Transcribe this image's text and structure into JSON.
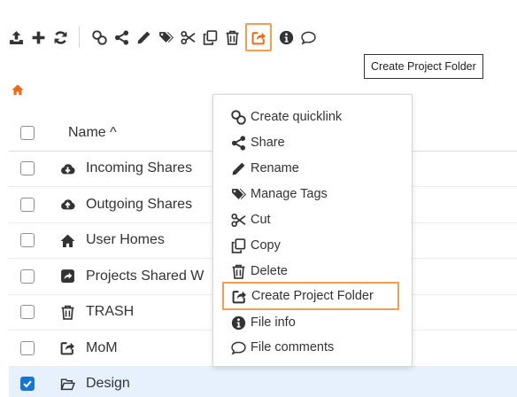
{
  "toolbar": {
    "buttons": [
      {
        "icon": "upload-icon"
      },
      {
        "icon": "plus-icon"
      },
      {
        "icon": "refresh-icon"
      },
      {
        "icon": "link-icon"
      },
      {
        "icon": "share-icon"
      },
      {
        "icon": "pencil-icon"
      },
      {
        "icon": "tags-icon"
      },
      {
        "icon": "scissors-icon"
      },
      {
        "icon": "copy-icon"
      },
      {
        "icon": "trash-icon"
      },
      {
        "icon": "project-folder-icon"
      },
      {
        "icon": "info-icon"
      },
      {
        "icon": "comment-icon"
      }
    ],
    "tooltip": "Create Project Folder"
  },
  "breadcrumb": {
    "icon": "home-icon"
  },
  "list": {
    "header": {
      "name_label": "Name ^"
    },
    "rows": [
      {
        "label": "Incoming Shares",
        "icon": "cloud-download-icon",
        "checked": false
      },
      {
        "label": "Outgoing Shares",
        "icon": "cloud-upload-icon",
        "checked": false
      },
      {
        "label": "User Homes",
        "icon": "home-icon",
        "checked": false
      },
      {
        "label": "Projects Shared W",
        "icon": "share-square-icon",
        "checked": false
      },
      {
        "label": "TRASH",
        "icon": "trash-icon",
        "checked": false
      },
      {
        "label": "MoM",
        "icon": "project-folder-icon",
        "checked": false
      },
      {
        "label": "Design",
        "icon": "folder-open-icon",
        "checked": true
      }
    ]
  },
  "context_menu": {
    "items": [
      {
        "label": "Create quicklink",
        "icon": "link-icon"
      },
      {
        "label": "Share",
        "icon": "share-icon"
      },
      {
        "label": "Rename",
        "icon": "pencil-icon"
      },
      {
        "label": "Manage Tags",
        "icon": "tags-icon"
      },
      {
        "label": "Cut",
        "icon": "scissors-icon"
      },
      {
        "label": "Copy",
        "icon": "copy-icon"
      },
      {
        "label": "Delete",
        "icon": "trash-icon"
      },
      {
        "label": "Create Project Folder",
        "icon": "project-folder-icon",
        "highlighted": true
      },
      {
        "label": "File info",
        "icon": "info-icon"
      },
      {
        "label": "File comments",
        "icon": "comment-icon"
      }
    ]
  },
  "colors": {
    "accent": "#ee6b1c",
    "highlight_border": "#f0a050",
    "selected_row": "#e6f1fd",
    "checkbox_checked": "#1677d3"
  }
}
